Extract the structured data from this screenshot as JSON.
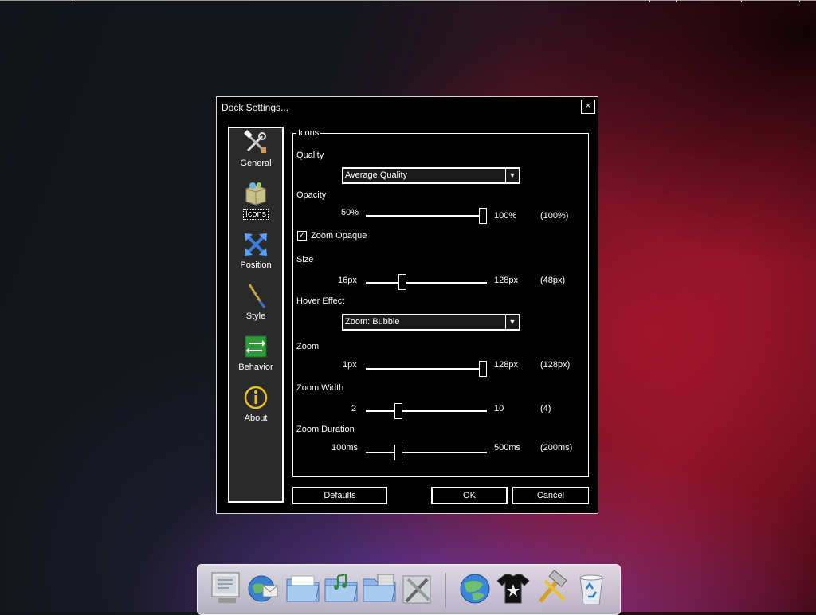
{
  "dialog": {
    "title": "Dock Settings...",
    "close_label": "×"
  },
  "sidebar": {
    "items": [
      {
        "label": "General",
        "icon": "tools-icon"
      },
      {
        "label": "Icons",
        "icon": "icons-box-icon"
      },
      {
        "label": "Position",
        "icon": "position-arrows-icon"
      },
      {
        "label": "Style",
        "icon": "brush-icon"
      },
      {
        "label": "Behavior",
        "icon": "behavior-arrows-icon"
      },
      {
        "label": "About",
        "icon": "info-icon"
      }
    ],
    "active": "Icons"
  },
  "icons_panel": {
    "group_title": "Icons",
    "quality": {
      "label": "Quality",
      "value": "Average Quality"
    },
    "opacity": {
      "label": "Opacity",
      "min": "50%",
      "max": "100%",
      "current": "(100%)",
      "fraction": 1.0
    },
    "zoom_opaque": {
      "label": "Zoom Opaque",
      "checked": true,
      "mark": "✓"
    },
    "size": {
      "label": "Size",
      "min": "16px",
      "max": "128px",
      "current": "(48px)",
      "fraction": 0.29
    },
    "hover_effect": {
      "label": "Hover Effect",
      "value": "Zoom: Bubble"
    },
    "zoom": {
      "label": "Zoom",
      "min": "1px",
      "max": "128px",
      "current": "(128px)",
      "fraction": 1.0
    },
    "zoom_width": {
      "label": "Zoom Width",
      "min": "2",
      "max": "10",
      "current": "(4)",
      "fraction": 0.25
    },
    "zoom_duration": {
      "label": "Zoom Duration",
      "min": "100ms",
      "max": "500ms",
      "current": "(200ms)",
      "fraction": 0.25
    }
  },
  "buttons": {
    "defaults": "Defaults",
    "ok": "OK",
    "cancel": "Cancel"
  },
  "dock": {
    "icons": [
      "monitor-icon",
      "globe-mail-icon",
      "folder-icon",
      "music-folder-icon",
      "pictures-folder-icon",
      "settings-tools-icon",
      "internet-globe-icon",
      "tshirt-icon",
      "hammer-icon",
      "recycle-bin-icon"
    ]
  },
  "colors": {
    "dialog_bg": "#000000",
    "sidebar_bg": "#2a2a2a",
    "text": "#ffffff"
  }
}
